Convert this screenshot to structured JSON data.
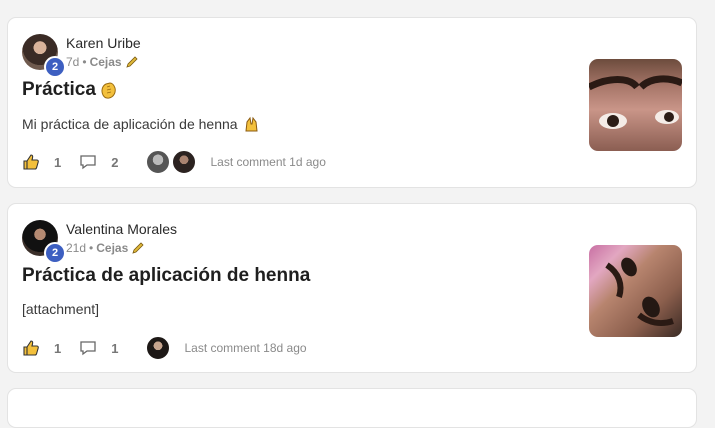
{
  "posts": [
    {
      "author": "Karen Uribe",
      "level": "2",
      "time_ago": "7d",
      "separator": "•",
      "category": "Cejas",
      "title": "Práctica",
      "body": "Mi práctica de aplicación de henna",
      "likes": "1",
      "comments": "2",
      "last_comment": "Last comment 1d ago"
    },
    {
      "author": "Valentina Morales",
      "level": "2",
      "time_ago": "21d",
      "separator": "•",
      "category": "Cejas",
      "title": "Práctica de aplicación de henna",
      "body": "[attachment]",
      "likes": "1",
      "comments": "1",
      "last_comment": "Last comment 18d ago"
    }
  ],
  "colors": {
    "badge": "#3d5fc1",
    "page_bg": "#f3f3f3",
    "card_bg": "#ffffff"
  }
}
